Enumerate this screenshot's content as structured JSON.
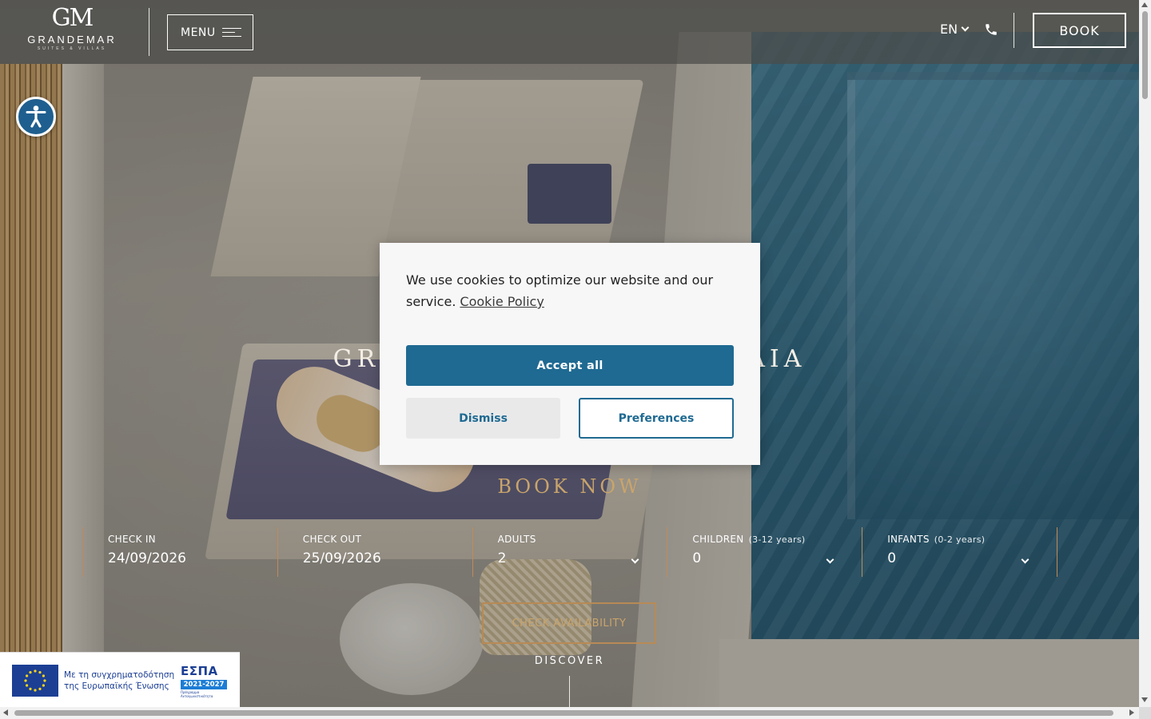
{
  "colors": {
    "accent_gold": "#c9a46b",
    "booking_divider": "#c08b57",
    "cookie_primary": "#1f6a92",
    "accessibility_blue": "#1f5f8f",
    "eu_blue": "#1c3f94"
  },
  "header": {
    "logo": {
      "mark": "GM",
      "name": "GRANDEMAR",
      "tagline": "SUITES & VILLAS"
    },
    "menu_label": "MENU",
    "language": "EN",
    "phone_icon": "phone-icon",
    "book_label": "BOOK"
  },
  "accessibility": {
    "icon": "accessibility-icon"
  },
  "hero": {
    "title": "GRANDEMAR SUITES & VILLAS AKROTIRI · KAMARI · PERISSA · MESARIA",
    "title_visible_left": "GR",
    "title_visible_right": "AIA",
    "book_now": "BOOK NOW"
  },
  "booking": {
    "fields": [
      {
        "label": "CHECK IN",
        "hint": "",
        "value": "24/09/2026",
        "type": "date"
      },
      {
        "label": "CHECK OUT",
        "hint": "",
        "value": "25/09/2026",
        "type": "date"
      },
      {
        "label": "ADULTS",
        "hint": "",
        "value": "2",
        "type": "select"
      },
      {
        "label": "CHILDREN",
        "hint": "(3-12 years)",
        "value": "0",
        "type": "select"
      },
      {
        "label": "INFANTS",
        "hint": "(0-2 years)",
        "value": "0",
        "type": "select"
      }
    ],
    "check_label": "CHECK AVAILABILITY"
  },
  "discover": {
    "label": "DISCOVER"
  },
  "espa_banner": {
    "line1": "Με τη συγχρηματοδότηση",
    "line2": "της Ευρωπαϊκής Ένωσης",
    "logo_word": "ΕΣΠΑ",
    "logo_years": "2021-2027",
    "logo_tag": "Πρόγραμμα Ανταγωνιστικότητα"
  },
  "cookie": {
    "message": "We use cookies to optimize our website and our service.",
    "policy_link": "Cookie Policy",
    "accept_label": "Accept all",
    "dismiss_label": "Dismiss",
    "preferences_label": "Preferences"
  }
}
